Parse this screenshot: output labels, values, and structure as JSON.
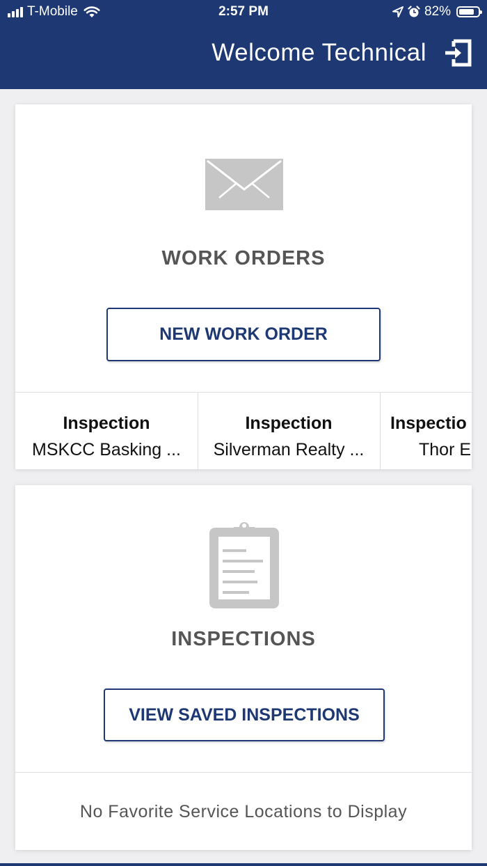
{
  "status_bar": {
    "carrier": "T-Mobile",
    "time": "2:57 PM",
    "battery": "82%",
    "battery_level": 0.82,
    "icons": [
      "signal-icon",
      "wifi-icon",
      "location-arrow-icon",
      "alarm-icon",
      "battery-icon"
    ]
  },
  "header": {
    "welcome_text": "Welcome Technical",
    "logout_icon": "logout-icon",
    "background": "#1d3872"
  },
  "work_orders": {
    "icon": "envelope-icon",
    "title": "WORK ORDERS",
    "button_label": "NEW WORK ORDER",
    "recent": [
      {
        "type": "Inspection",
        "location": "MSKCC Basking ..."
      },
      {
        "type": "Inspection",
        "location": "Silverman Realty ..."
      },
      {
        "type": "Inspectio",
        "location": "Thor E"
      }
    ]
  },
  "inspections": {
    "icon": "clipboard-icon",
    "title": "INSPECTIONS",
    "button_label": "VIEW SAVED INSPECTIONS",
    "empty_message": "No Favorite Service Locations to Display"
  },
  "colors": {
    "accent": "#1d3872",
    "icon_gray": "#c6c6c6",
    "title_gray": "#555555",
    "page_bg": "#efeff1"
  }
}
